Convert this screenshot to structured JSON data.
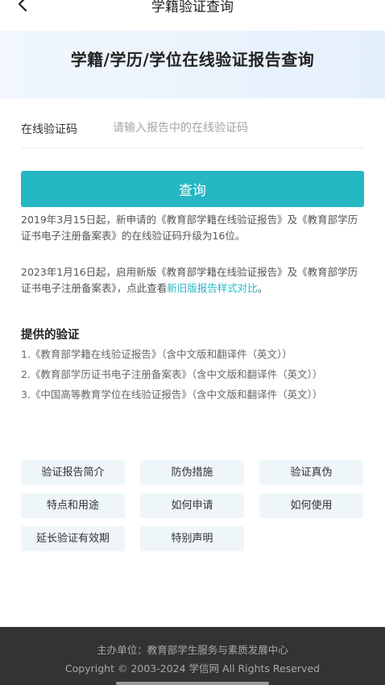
{
  "nav": {
    "title": "学籍验证查询"
  },
  "banner": {
    "title": "学籍/学历/学位在线验证报告查询"
  },
  "form": {
    "label": "在线验证码",
    "placeholder": "请输入报告中的在线验证码",
    "value": ""
  },
  "query_button": {
    "label": "查询"
  },
  "notices": {
    "n1": "2019年3月15日起，新申请的《教育部学籍在线验证报告》及《教育部学历证书电子注册备案表》的在线验证码升级为16位。",
    "n2_prefix": "2023年1月16日起，启用新版《教育部学籍在线验证报告》及《教育部学历证书电子注册备案表》，点此查看",
    "n2_link": "新旧版报告样式对比",
    "n2_suffix": "。"
  },
  "provided": {
    "title": "提供的验证",
    "items": [
      "1.《教育部学籍在线验证报告》（含中文版和翻译件（英文））",
      "2.《教育部学历证书电子注册备案表》（含中文版和翻译件（英文））",
      "3.《中国高等教育学位在线验证报告》（含中文版和翻译件（英文））"
    ]
  },
  "tags": [
    "验证报告简介",
    "防伪措施",
    "验证真伪",
    "特点和用途",
    "如何申请",
    "如何使用",
    "延长验证有效期",
    "特别声明"
  ],
  "footer": {
    "host": "主办单位：教育部学生服务与素质发展中心",
    "copyright": "Copyright © 2003-2024 学信网 All Rights Reserved"
  },
  "colors": {
    "accent": "#26b7c4",
    "footer_bg": "#333333",
    "tag_bg": "#eef6f9"
  },
  "icons": {
    "back": "chevron-left-icon"
  }
}
